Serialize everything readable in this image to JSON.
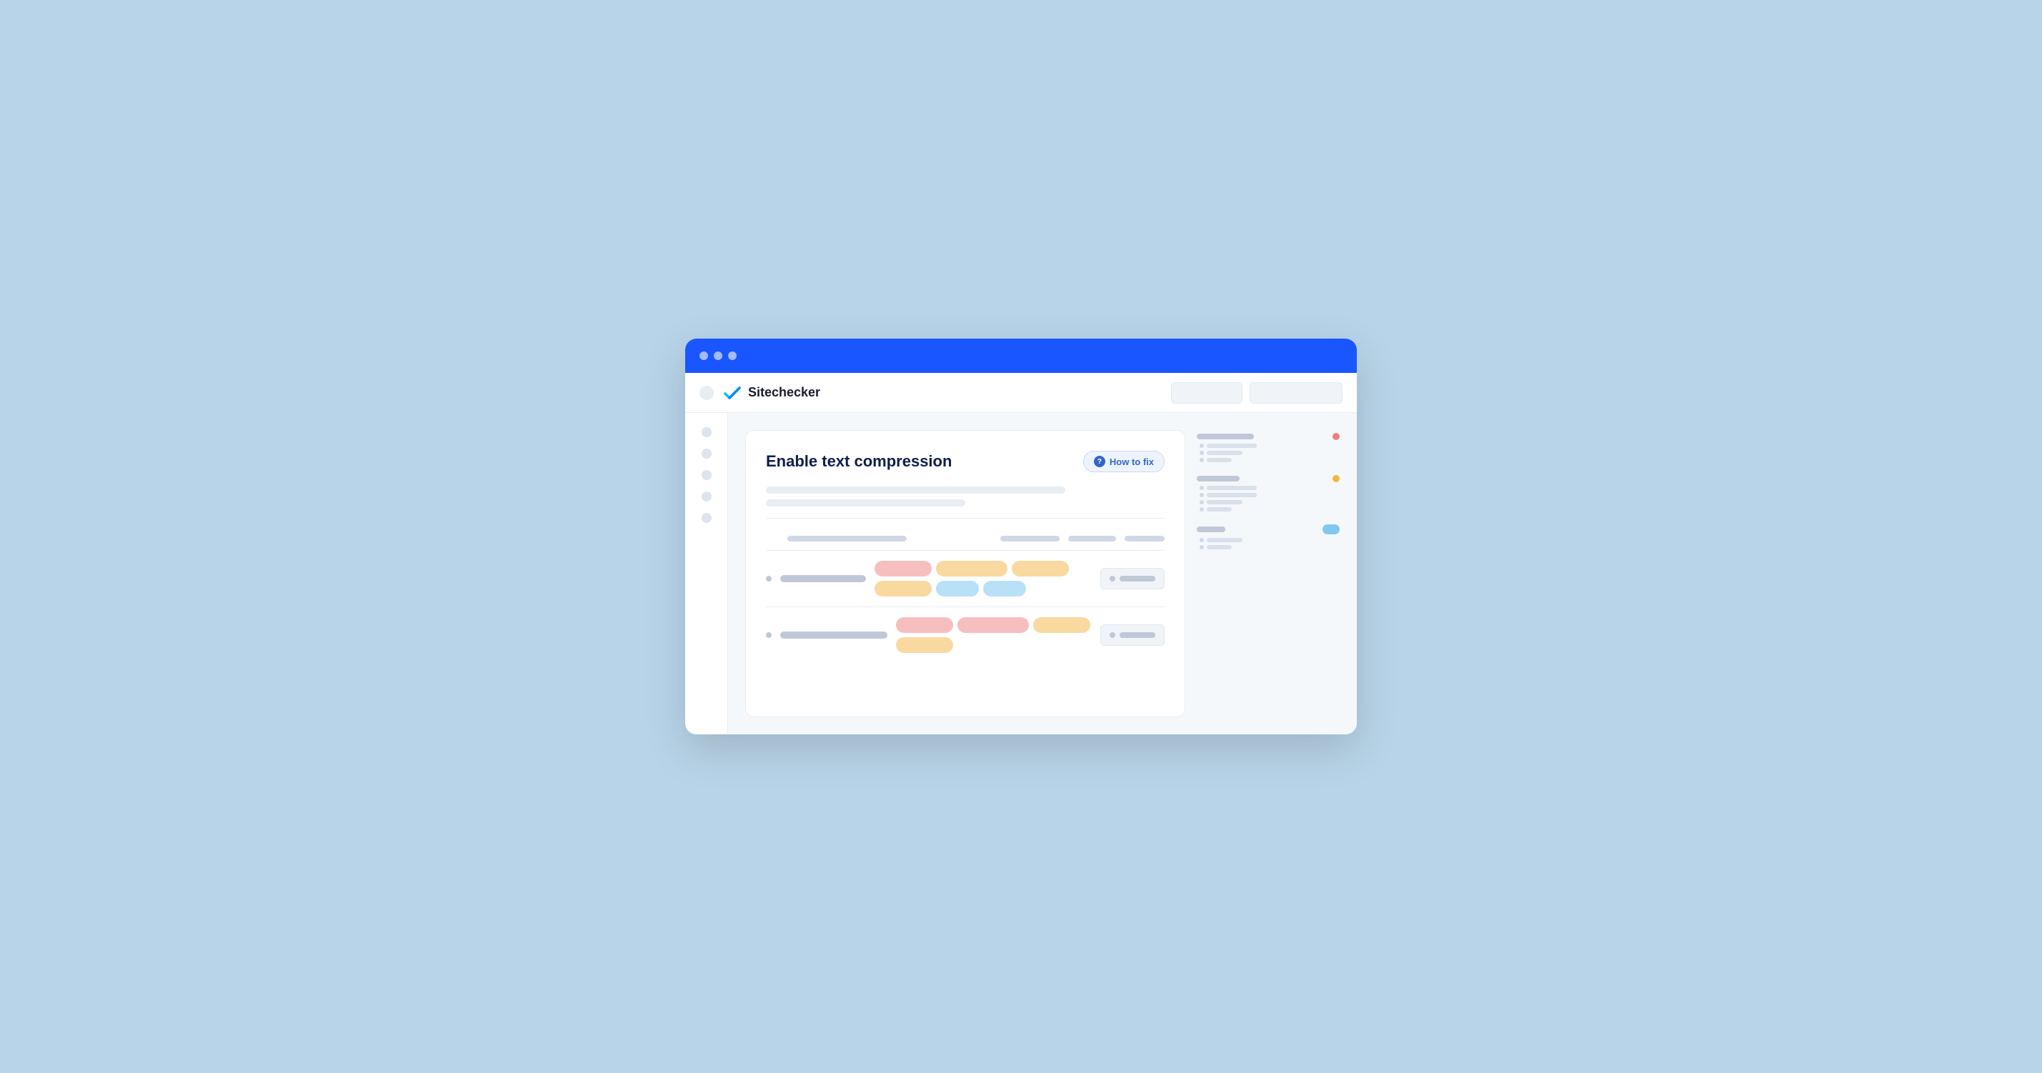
{
  "browser": {
    "title": "Sitechecker",
    "logo_text": "Sitechecker",
    "traffic_lights": [
      "close",
      "minimize",
      "maximize"
    ]
  },
  "toolbar": {
    "btn1_label": "",
    "btn2_label": ""
  },
  "panel": {
    "title": "Enable text compression",
    "description_line1": "",
    "description_line2": "",
    "how_to_fix_label": "How to fix"
  },
  "table": {
    "headers": [
      "url",
      "type1",
      "type2",
      "action"
    ],
    "rows": [
      {
        "id": "row-1",
        "label": "",
        "tags": [
          {
            "color": "pink",
            "size": "md"
          },
          {
            "color": "orange",
            "size": "lg"
          },
          {
            "color": "orange",
            "size": "md"
          },
          {
            "color": "orange",
            "size": "md"
          },
          {
            "color": "blue",
            "size": "md"
          },
          {
            "color": "blue",
            "size": "sm"
          }
        ],
        "action": ""
      },
      {
        "id": "row-2",
        "label": "",
        "tags": [
          {
            "color": "pink",
            "size": "md"
          },
          {
            "color": "pink",
            "size": "lg"
          },
          {
            "color": "orange",
            "size": "md"
          },
          {
            "color": "orange",
            "size": "md"
          }
        ],
        "action": ""
      }
    ]
  },
  "right_sidebar": {
    "sections": [
      {
        "id": "section-1",
        "main_bar": "lg",
        "dot_color": "red",
        "sub_rows": [
          {
            "bar": "lg"
          },
          {
            "bar": "md"
          },
          {
            "bar": "sm"
          }
        ]
      },
      {
        "id": "section-2",
        "main_bar": "md",
        "dot_color": "orange",
        "sub_rows": [
          {
            "bar": "lg"
          },
          {
            "bar": "lg"
          },
          {
            "bar": "md"
          },
          {
            "bar": "sm"
          }
        ]
      },
      {
        "id": "section-3",
        "main_bar": "sm",
        "dot_color": "blue",
        "oval": true,
        "sub_rows": [
          {
            "bar": "md"
          },
          {
            "bar": "sm"
          }
        ]
      }
    ]
  }
}
